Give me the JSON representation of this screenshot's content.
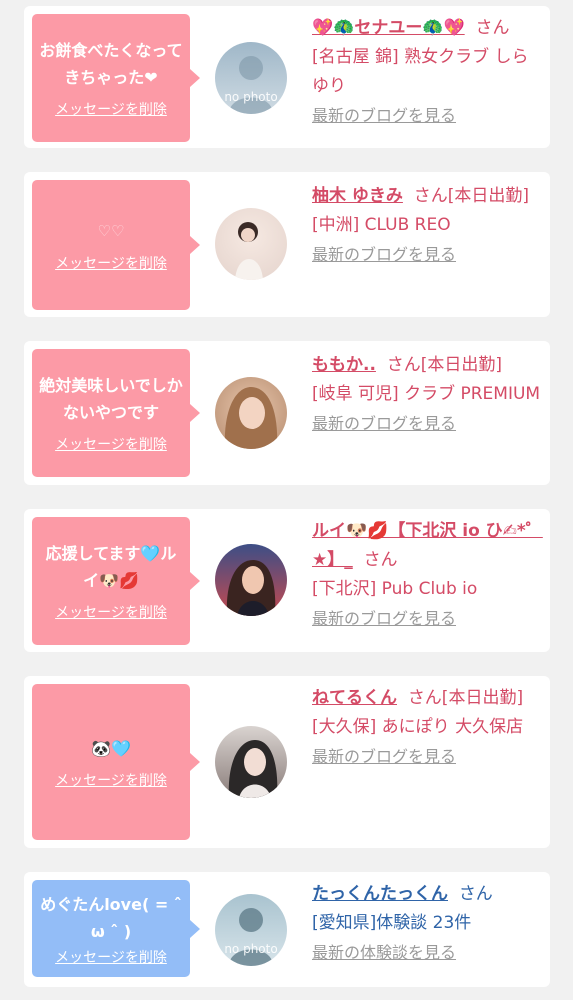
{
  "cards": [
    {
      "message": "お餅食べたくなってきちゃった❤",
      "delete_label": "メッセージを削除",
      "name": "💖🦚セナユー🦚💖",
      "honorific": "さん",
      "location": "[名古屋 錦] 熟女クラブ しらゆり",
      "link": "最新のブログを見る",
      "avatar_text": "no photo"
    },
    {
      "message": "♡♡",
      "delete_label": "メッセージを削除",
      "name": "柚木 ゆきみ",
      "honorific": "さん[本日出勤]",
      "location": "[中洲] CLUB REO",
      "link": "最新のブログを見る"
    },
    {
      "message": "絶対美味しいでしかないやつです",
      "delete_label": "メッセージを削除",
      "name": "ももか..",
      "honorific": "さん[本日出勤]",
      "location": "[岐阜 可児] クラブ PREMIUM",
      "link": "最新のブログを見る"
    },
    {
      "message": "応援してます🩵ルイ🐶💋",
      "delete_label": "メッセージを削除",
      "name": "ルイ🐶💋【下北沢 io ひ✍︎*゜★】_",
      "honorific": "さん",
      "location": "[下北沢] Pub Club io",
      "link": "最新のブログを見る"
    },
    {
      "message": "🐼🩵",
      "delete_label": "メッセージを削除",
      "name": "ねてるくん",
      "honorific": "さん[本日出勤]",
      "location": "[大久保] あにぽり 大久保店",
      "link": "最新のブログを見る"
    },
    {
      "message": "めぐたんlove( = ˆ ω ˆ )",
      "delete_label": "メッセージを削除",
      "name": "たっくんたっくん",
      "honorific": "さん",
      "location": "[愛知県]体験談 23件",
      "link": "最新の体験談を見る",
      "avatar_text": "no photo"
    }
  ],
  "colors": {
    "pink_bubble": "#fc9aa6",
    "blue_bubble": "#93bdf7",
    "pink_text": "#d44b66",
    "blue_text": "#2f64a8",
    "link_gray": "#9a9a9a"
  }
}
